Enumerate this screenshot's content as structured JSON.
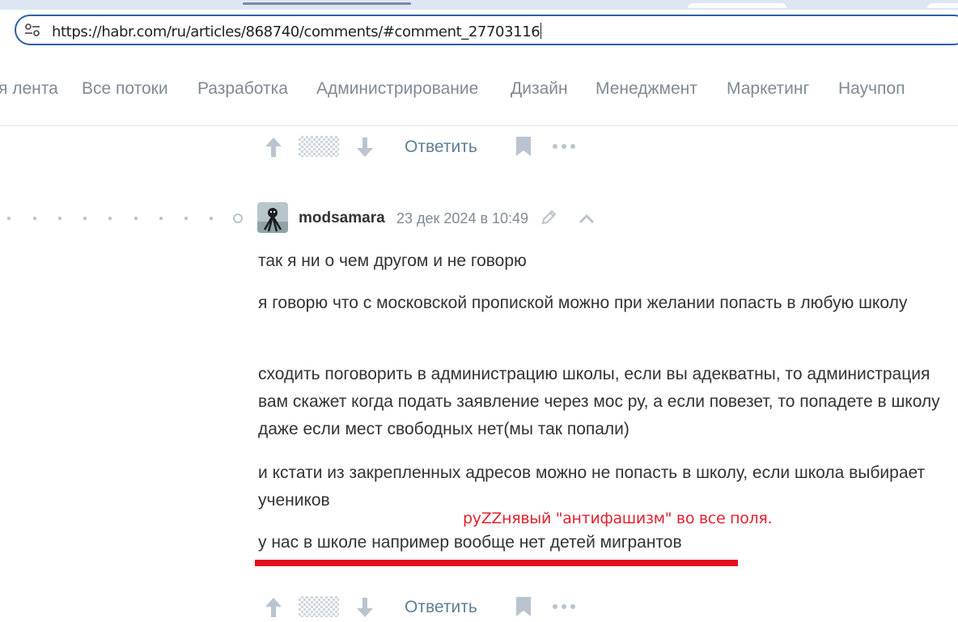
{
  "browser": {
    "url": "https://habr.com/ru/articles/868740/comments/#comment_27703116"
  },
  "nav": {
    "items": [
      "я лента",
      "Все потоки",
      "Разработка",
      "Администрирование",
      "Дизайн",
      "Менеджмент",
      "Маркетинг",
      "Научпоп"
    ]
  },
  "actions": {
    "reply_label": "Ответить"
  },
  "comment": {
    "author": "modsamara",
    "timestamp": "23 дек 2024 в 10:49",
    "paragraphs": [
      "так я ни о чем другом и не говорю",
      "я говорю что с московской пропиской можно при желании попасть в любую школу",
      "сходить поговорить в администрацию школы, если вы адекватны, то администрация вам скажет когда подать заявление через мос ру, а если повезет, то попадете в школу даже если мест свободных нет(мы так попали)",
      "и кстати из закрепленных адресов можно не попасть в школу, если школа выбирает учеников",
      "у нас в школе например вообще нет детей мигрантов"
    ]
  },
  "annotation": {
    "text": "руZZнявый \"антифашизм\" во все поля.",
    "color": "#e3222e"
  },
  "icons": {
    "vote_up": "arrow-up-icon",
    "vote_down": "arrow-down-icon",
    "bookmark": "bookmark-icon",
    "more": "more-dots-icon",
    "edit": "pencil-icon",
    "collapse": "chevron-up-icon",
    "site_info": "tune-icon"
  },
  "colors": {
    "link": "#5e7e96",
    "nav_text": "#808a94",
    "address_border": "#2e5fa8"
  }
}
